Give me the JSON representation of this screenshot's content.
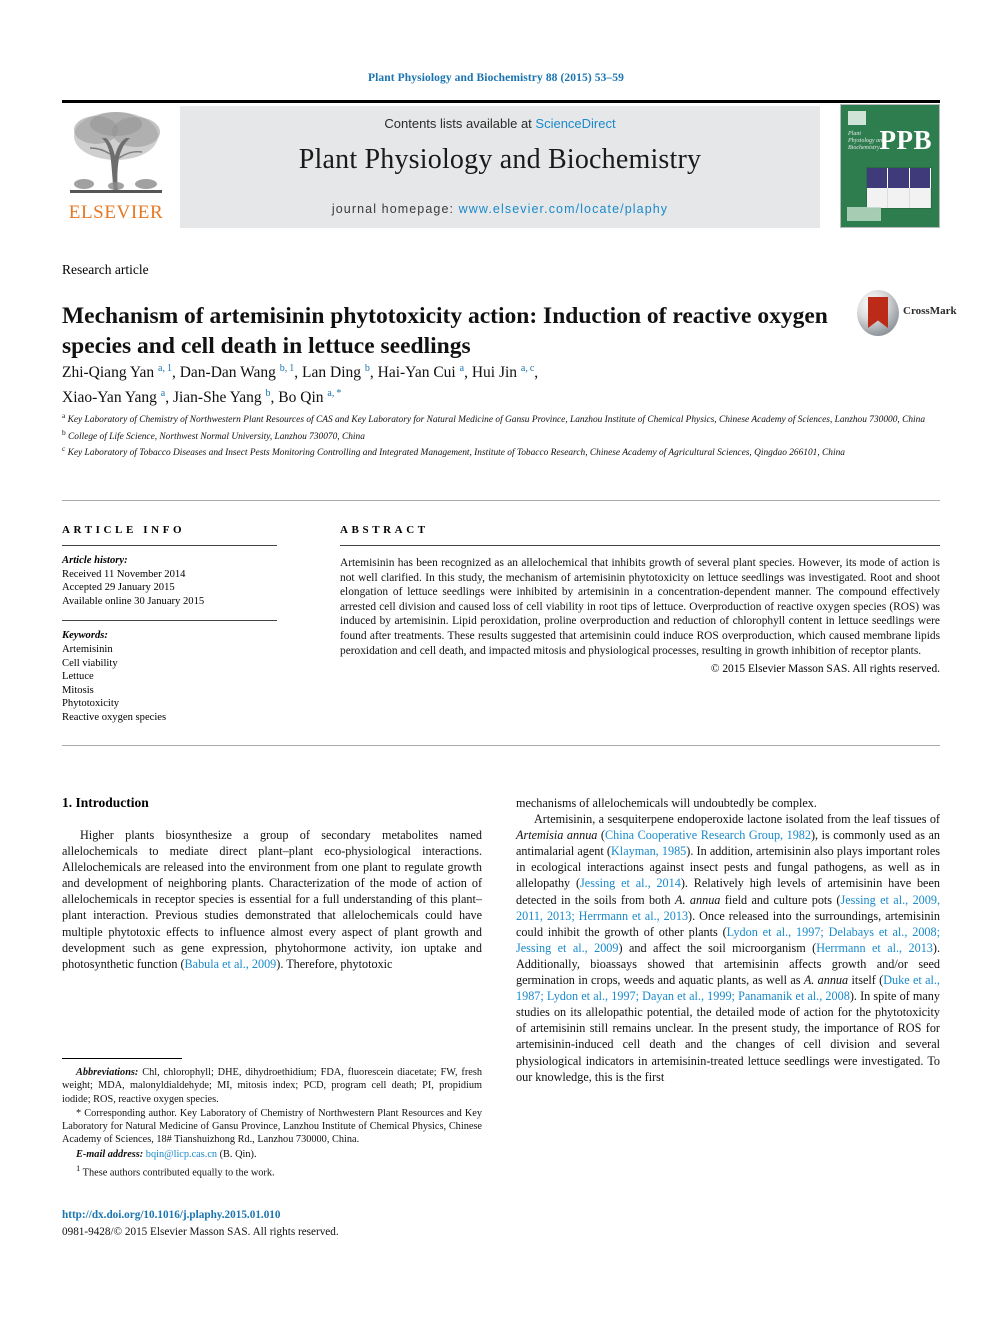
{
  "running_head": "Plant Physiology and Biochemistry 88 (2015) 53–59",
  "masthead": {
    "contents_prefix": "Contents lists available at ",
    "sciencedirect": "ScienceDirect",
    "journal_title": "Plant Physiology and Biochemistry",
    "homepage_prefix": "journal homepage: ",
    "homepage_url": "www.elsevier.com/locate/plaphy",
    "publisher": "ELSEVIER",
    "cover_letters": "PPB",
    "cover_small_title": "Plant Physiology and Biochemistry"
  },
  "article": {
    "type": "Research article",
    "title": "Mechanism of artemisinin phytotoxicity action: Induction of reactive oxygen species and cell death in lettuce seedlings",
    "crossmark_label": "CrossMark",
    "authors_line1": "Zhi-Qiang Yan <sup>a,&#8201;1</sup>, Dan-Dan Wang <sup>b,&#8201;1</sup>, Lan Ding <sup>b</sup>, Hai-Yan Cui <sup>a</sup>, Hui Jin <sup>a,&#8201;c</sup>,",
    "authors_line2": "Xiao-Yan Yang <sup>a</sup>, Jian-She Yang <sup>b</sup>, Bo Qin <sup>a,&#8201;*</sup>",
    "affiliations": [
      "<sup>a</sup> Key Laboratory of Chemistry of Northwestern Plant Resources of CAS and Key Laboratory for Natural Medicine of Gansu Province, Lanzhou Institute of Chemical Physics, Chinese Academy of Sciences, Lanzhou 730000, China",
      "<sup>b</sup> College of Life Science, Northwest Normal University, Lanzhou 730070, China",
      "<sup>c</sup> Key Laboratory of Tobacco Diseases and Insect Pests Monitoring Controlling and Integrated Management, Institute of Tobacco Research, Chinese Academy of Agricultural Sciences, Qingdao 266101, China"
    ]
  },
  "article_info": {
    "heading": "ARTICLE INFO",
    "history_label": "Article history:",
    "history": [
      "Received 11 November 2014",
      "Accepted 29 January 2015",
      "Available online 30 January 2015"
    ],
    "keywords_label": "Keywords:",
    "keywords": [
      "Artemisinin",
      "Cell viability",
      "Lettuce",
      "Mitosis",
      "Phytotoxicity",
      "Reactive oxygen species"
    ]
  },
  "abstract": {
    "heading": "ABSTRACT",
    "body": "Artemisinin has been recognized as an allelochemical that inhibits growth of several plant species. However, its mode of action is not well clarified. In this study, the mechanism of artemisinin phytotoxicity on lettuce seedlings was investigated. Root and shoot elongation of lettuce seedlings were inhibited by artemisinin in a concentration-dependent manner. The compound effectively arrested cell division and caused loss of cell viability in root tips of lettuce. Overproduction of reactive oxygen species (ROS) was induced by artemisinin. Lipid peroxidation, proline overproduction and reduction of chlorophyll content in lettuce seedlings were found after treatments. These results suggested that artemisinin could induce ROS overproduction, which caused membrane lipids peroxidation and cell death, and impacted mitosis and physiological processes, resulting in growth inhibition of receptor plants.",
    "copyright": "© 2015 Elsevier Masson SAS. All rights reserved."
  },
  "body": {
    "section_heading": "1. Introduction",
    "left_paragraph": "Higher plants biosynthesize a group of secondary metabolites named allelochemicals to mediate direct plant–plant eco-physiological interactions. Allelochemicals are released into the environment from one plant to regulate growth and development of neighboring plants. Characterization of the mode of action of allelochemicals in receptor species is essential for a full understanding of this plant–plant interaction. Previous studies demonstrated that allelochemicals could have multiple phytotoxic effects to influence almost every aspect of plant growth and development such as gene expression, phytohormone activity, ion uptake and photosynthetic function (<span class=\"cite\">Babula et al., 2009</span>). Therefore, phytotoxic",
    "right_paragraph_1": "mechanisms of allelochemicals will undoubtedly be complex.",
    "right_paragraph_2": "Artemisinin, a sesquiterpene endoperoxide lactone isolated from the leaf tissues of <i>Artemisia annua</i> (<span class=\"cite\">China Cooperative Research Group, 1982</span>), is commonly used as an antimalarial agent (<span class=\"cite\">Klayman, 1985</span>). In addition, artemisinin also plays important roles in ecological interactions against insect pests and fungal pathogens, as well as in allelopathy (<span class=\"cite\">Jessing et al., 2014</span>). Relatively high levels of artemisinin have been detected in the soils from both <i>A. annua</i> field and culture pots (<span class=\"cite\">Jessing et al., 2009, 2011, 2013; Herrmann et al., 2013</span>). Once released into the surroundings, artemisinin could inhibit the growth of other plants (<span class=\"cite\">Lydon et al., 1997; Delabays et al., 2008; Jessing et al., 2009</span>) and affect the soil microorganism (<span class=\"cite\">Herrmann et al., 2013</span>). Additionally, bioassays showed that artemisinin affects growth and/or seed germination in crops, weeds and aquatic plants, as well as <i>A. annua</i> itself (<span class=\"cite\">Duke et al., 1987; Lydon et al., 1997; Dayan et al., 1999; Panamanik et al., 2008</span>). In spite of many studies on its allelopathic potential, the detailed mode of action for the phytotoxicity of artemisinin still remains unclear. In the present study, the importance of ROS for artemisinin-induced cell death and the changes of cell division and several physiological indicators in artemisinin-treated lettuce seedlings were investigated. To our knowledge, this is the first"
  },
  "footnotes": {
    "abbreviations": "<span class=\"it\">Abbreviations:</span> Chl, chlorophyll; DHE, dihydroethidium; FDA, fluorescein diacetate; FW, fresh weight; MDA, malonyldialdehyde; MI, mitosis index; PCD, program cell death; PI, propidium iodide; ROS, reactive oxygen species.",
    "corresponding": "* Corresponding author. Key Laboratory of Chemistry of Northwestern Plant Resources and Key Laboratory for Natural Medicine of Gansu Province, Lanzhou Institute of Chemical Physics, Chinese Academy of Sciences, 18# Tianshuizhong Rd., Lanzhou 730000, China.",
    "email": "<span class=\"it\">E-mail address:</span> <span class=\"lnk\">bqin@licp.cas.cn</span> (B. Qin).",
    "equal_contribution": "<sup>1</sup> These authors contributed equally to the work."
  },
  "footer": {
    "doi": "http://dx.doi.org/10.1016/j.plaphy.2015.01.010",
    "issn": "0981-9428/© 2015 Elsevier Masson SAS. All rights reserved."
  },
  "colors": {
    "link_blue": "#1a8acb",
    "head_blue": "#1a74b0",
    "elsevier_orange": "#e87722",
    "cover_green": "#2e7d4f",
    "crossmark_red": "#bb2b18"
  }
}
